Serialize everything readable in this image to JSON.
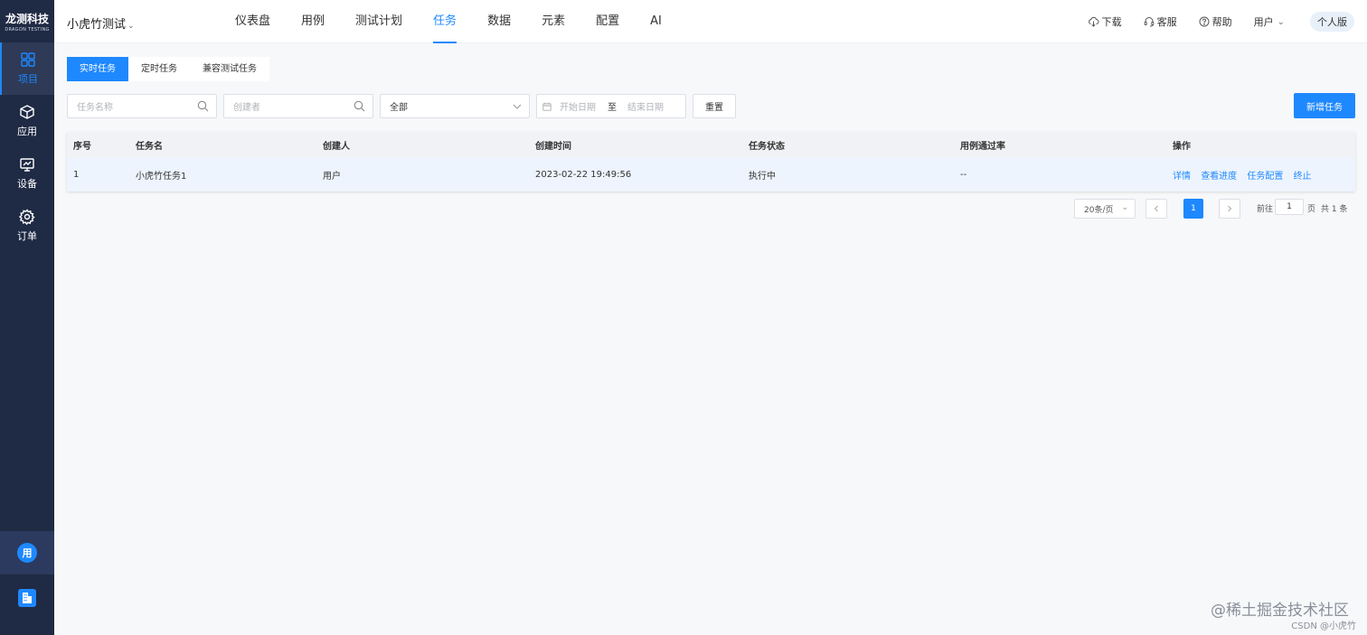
{
  "brand": {
    "logo_main": "龙测科技",
    "logo_sub": "DRAGON TESTING"
  },
  "sidebar": {
    "items": [
      {
        "label": "项目",
        "icon": "grid-icon",
        "active": true
      },
      {
        "label": "应用",
        "icon": "cube-icon",
        "active": false
      },
      {
        "label": "设备",
        "icon": "monitor-icon",
        "active": false
      },
      {
        "label": "订单",
        "icon": "gear-icon",
        "active": false
      }
    ],
    "avatar_text": "用",
    "bottom_icon": "building-icon"
  },
  "header": {
    "project_name": "小虎竹测试",
    "nav": [
      {
        "label": "仪表盘"
      },
      {
        "label": "用例"
      },
      {
        "label": "测试计划"
      },
      {
        "label": "任务",
        "active": true
      },
      {
        "label": "数据"
      },
      {
        "label": "元素"
      },
      {
        "label": "配置"
      },
      {
        "label": "AI"
      }
    ],
    "download": "下载",
    "service": "客服",
    "help": "帮助",
    "user": "用户",
    "edition": "个人版"
  },
  "tabs": [
    {
      "label": "实时任务",
      "active": true
    },
    {
      "label": "定时任务"
    },
    {
      "label": "兼容测试任务"
    }
  ],
  "filters": {
    "task_name_placeholder": "任务名称",
    "creator_placeholder": "创建者",
    "status_value": "全部",
    "start_date_placeholder": "开始日期",
    "date_separator": "至",
    "end_date_placeholder": "结束日期",
    "reset": "重置",
    "new_task": "新增任务"
  },
  "table": {
    "headers": [
      "序号",
      "任务名",
      "创建人",
      "创建时间",
      "任务状态",
      "用例通过率",
      "操作"
    ],
    "rows": [
      {
        "index": "1",
        "name": "小虎竹任务1",
        "creator": "用户",
        "created_at": "2023-02-22 19:49:56",
        "status": "执行中",
        "pass_rate": "--"
      }
    ],
    "actions": [
      "详情",
      "查看进度",
      "任务配置",
      "终止"
    ]
  },
  "pagination": {
    "page_size": "20条/页",
    "current_page": "1",
    "goto_label": "前往",
    "goto_value": "1",
    "page_unit": "页",
    "total": "共 1 条"
  },
  "watermark": {
    "line1": "@稀土掘金技术社区",
    "line2": "CSDN @小虎竹"
  },
  "colors": {
    "primary": "#1e88ff",
    "sidebar_bg": "#1f2a44"
  }
}
